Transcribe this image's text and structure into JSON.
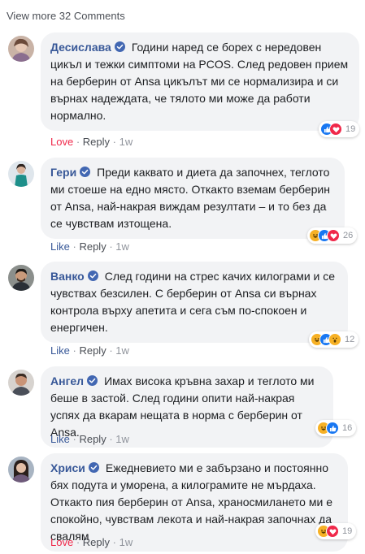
{
  "view_more": "View more 32 Comments",
  "action_separator": "·",
  "comments": [
    {
      "name": "Десислава",
      "text": "Години наред се борех с нередовен цикъл и тежки симптоми на PCOS. След редовен прием на берберин от Ansa цикълът ми се нормализира и си върнах надеждата, че тялото ми може да работи нормално.",
      "primary_action": "Love",
      "primary_action_color": "#f0284a",
      "reply": "Reply",
      "time": "1w",
      "reaction_icons": [
        "like-icon",
        "love-icon"
      ],
      "reaction_count": "19"
    },
    {
      "name": "Гери",
      "text": "Преди каквато и диета да започнех, теглото ми стоеше на едно място. Откакто вземам берберин от Ansa, най-накрая виждам резултати – и то без да се чувствам изтощена.",
      "primary_action": "Like",
      "primary_action_color": "#385898",
      "reply": "Reply",
      "time": "1w",
      "reaction_icons": [
        "haha-icon",
        "like-icon",
        "love-icon"
      ],
      "reaction_count": "26"
    },
    {
      "name": "Ванко",
      "text": "След години на стрес качих килограми и се чувствах безсилен. С берберин от Ansa си върнах контрола върху апетита и сега съм по-спокоен и енергичен.",
      "primary_action": "Like",
      "primary_action_color": "#385898",
      "reply": "Reply",
      "time": "1w",
      "reaction_icons": [
        "haha-icon",
        "like-icon",
        "wow-icon"
      ],
      "reaction_count": "12"
    },
    {
      "name": "Ангел",
      "text": "Имах висока кръвна захар и теглото ми беше в застой. След години опити най-накрая успях да вкарам нещата в норма с берберин от Ansa.",
      "primary_action": "Like",
      "primary_action_color": "#385898",
      "reply": "Reply",
      "time": "1w",
      "reaction_icons": [
        "haha-icon",
        "like-icon"
      ],
      "reaction_count": "16"
    },
    {
      "name": "Хриси",
      "text": "Ежедневието ми е забързано и постоянно бях подута и уморена, а килограмите не мърдаха. Откакто пия берберин от Ansa, храносмилането ми е спокойно, чувствам лекота и най-накрая започнах да свалям",
      "primary_action": "Love",
      "primary_action_color": "#f0284a",
      "reply": "Reply",
      "time": "1w",
      "reaction_icons": [
        "haha-icon",
        "love-icon"
      ],
      "reaction_count": "19"
    }
  ],
  "colors": {
    "name": "#385898",
    "bubble": "#f2f3f5",
    "like": "#1877f2",
    "love": "#f0284a",
    "haha": "#f7b125",
    "meta": "#90949c"
  }
}
